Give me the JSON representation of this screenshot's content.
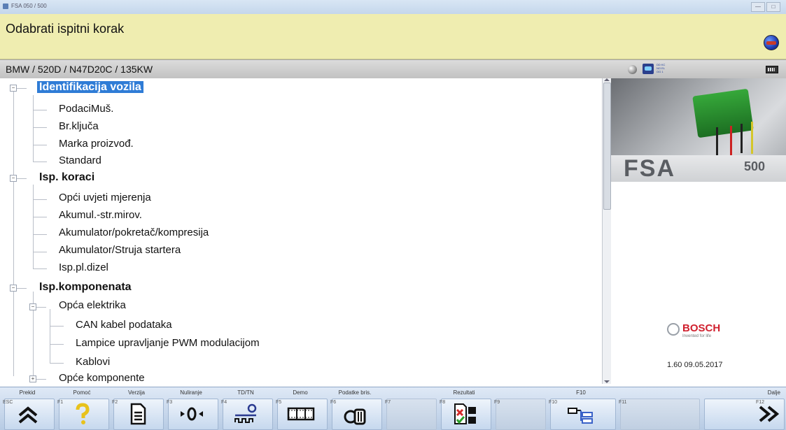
{
  "window": {
    "title": "FSA 050 / 500",
    "buttons": [
      "—",
      "□",
      "✕"
    ]
  },
  "header": {
    "title": "Odabrati ispitni korak",
    "icon": "globe-icon"
  },
  "vehicle": {
    "text": "BMW / 520D / N47D20C / 135KW",
    "status_mini_text": "DD KC NO EL OG 1"
  },
  "tree": {
    "groups": [
      {
        "label": "Identifikacija vozila",
        "selected": true,
        "items": [
          "PodaciMuš.",
          "Br.ključa",
          "Marka proizvođ.",
          "Standard"
        ]
      },
      {
        "label": "Isp. koraci",
        "items": [
          "Opći uvjeti mjerenja",
          "Akumul.-str.mirov.",
          "Akumulator/pokretač/kompresija",
          "Akumulator/Struja startera",
          "Isp.pl.dizel"
        ]
      },
      {
        "label": "Isp.komponenata",
        "subgroups": [
          {
            "label": "Opća elektrika",
            "items": [
              "CAN kabel podataka",
              "Lampice upravljanje PWM modulacijom",
              "Kablovi"
            ]
          },
          {
            "label": "Opće komponente"
          }
        ]
      }
    ]
  },
  "sidepanel": {
    "product": "FSA",
    "model": "500",
    "brand": "BOSCH",
    "tagline": "Invented for life",
    "version": "1.60 09.05.2017"
  },
  "fkeys": [
    {
      "code": "ESC",
      "label": "Prekid",
      "icon": "double-chevron-up-icon"
    },
    {
      "code": "F1",
      "label": "Pomoć",
      "icon": "question-icon"
    },
    {
      "code": "F2",
      "label": "Verzija",
      "icon": "document-icon"
    },
    {
      "code": "F3",
      "label": "Nuliranje",
      "icon": "zero-adjust-icon"
    },
    {
      "code": "F4",
      "label": "TD/TN",
      "icon": "probe-signal-icon"
    },
    {
      "code": "F5",
      "label": "Demo",
      "icon": "film-icon"
    },
    {
      "code": "F6",
      "label": "Podatke bris.",
      "icon": "delete-data-icon"
    },
    {
      "code": "F7",
      "label": "",
      "icon": ""
    },
    {
      "code": "F8",
      "label": "Rezultati",
      "icon": "results-icon"
    },
    {
      "code": "F9",
      "label": "",
      "icon": ""
    },
    {
      "code": "F10",
      "label": "F10",
      "icon": "tree-structure-icon"
    },
    {
      "code": "F11",
      "label": "",
      "icon": ""
    },
    {
      "code": "F12",
      "label": "Dalje",
      "icon": "double-chevron-right-icon"
    }
  ],
  "colors": {
    "header_bg": "#efedb0",
    "selection": "#2f7cd6",
    "bosch_red": "#d0202e"
  }
}
